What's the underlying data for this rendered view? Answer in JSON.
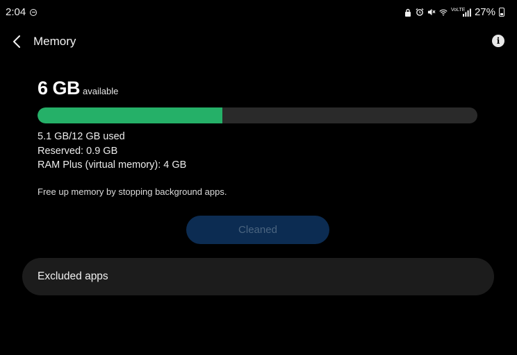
{
  "status_bar": {
    "time": "2:04",
    "battery_percent": "27%",
    "icons": [
      "dnd-icon",
      "lock-icon",
      "alarm-icon",
      "mute-icon",
      "wifi-icon",
      "volte-icon",
      "signal-icon",
      "battery-icon"
    ],
    "volte_text": "VoLTE"
  },
  "header": {
    "title": "Memory",
    "back_icon": "chevron-left-icon",
    "info_icon": "info-icon",
    "info_glyph": "i"
  },
  "memory": {
    "available_value": "6 GB",
    "available_label": "available",
    "used_fraction": 0.42,
    "used_line": "5.1 GB/12 GB used",
    "reserved_line": "Reserved: 0.9 GB",
    "ram_plus_line": "RAM Plus (virtual memory): 4 GB",
    "hint": "Free up memory by stopping background apps."
  },
  "actions": {
    "cleaned_label": "Cleaned"
  },
  "excluded": {
    "label": "Excluded apps"
  },
  "colors": {
    "background": "#000000",
    "progress_fill": "#25b068",
    "progress_track": "#2a2a2a",
    "button_bg": "#0c2c52",
    "button_text": "#4b6580",
    "card_bg": "#1c1c1c"
  }
}
